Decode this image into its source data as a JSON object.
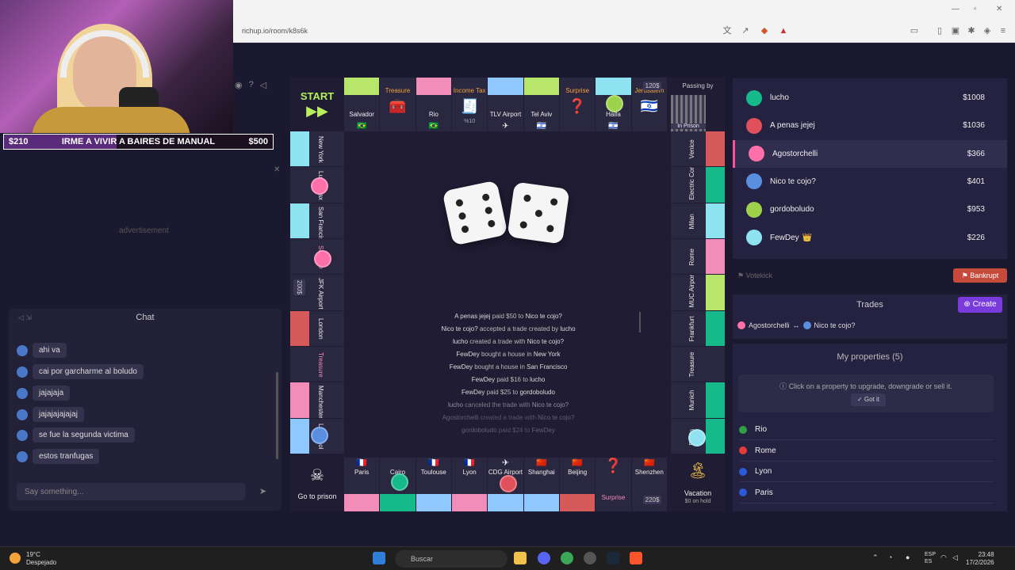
{
  "browser": {
    "url": "richup.io/room/k8s6k"
  },
  "stream_goal": {
    "current": "$210",
    "text": "IRME A VIVIR A BAIRES DE MANUAL",
    "target": "$500",
    "progress": 0.42
  },
  "left_panel": {
    "advertisement_label": "advertisement",
    "chat": {
      "title": "Chat",
      "messages": [
        "ahi va",
        "cai por garcharme al boludo",
        "jajajaja",
        "jajajajajajaj",
        "se fue la segunda victima",
        "estos tranfugas"
      ],
      "input_placeholder": "Say something..."
    }
  },
  "board": {
    "top_row": [
      "Salvador",
      "Treasure",
      "Rio",
      "Income Tax",
      "TLV Airport",
      "Tel Aviv",
      "Surprise",
      "Haifa",
      "Jerusalem"
    ],
    "corners": {
      "start": "START",
      "passing_by": "Passing by",
      "in_prison": "In Prison",
      "go_to_prison": "Go to prison",
      "vacation": "Vacation",
      "vacation_sub": "$0 on hold"
    },
    "income_tax_sub": "%10",
    "price_top": "120$",
    "price_bottom": "220$",
    "price_left": "200$",
    "left_col": [
      "New York",
      "Luxury tax",
      "San Francisco",
      "Surprise",
      "JFK Airport",
      "London",
      "Treasure",
      "Manchester",
      "Liverpool"
    ],
    "right_col": [
      "Venice",
      "Electric Company",
      "Milan",
      "Rome",
      "MUC Airport",
      "Frankfurt",
      "Treasure",
      "Munich",
      "Berlin"
    ],
    "bottom_row": [
      "Paris",
      "Cairo",
      "Toulouse",
      "Lyon",
      "CDG Airport",
      "Shanghai",
      "Beijing",
      "Surprise",
      "Shenzhen"
    ],
    "log": [
      {
        "a": "A penas jejej",
        "t": "paid $50 to",
        "b": "Nico te cojo?"
      },
      {
        "a": "Nico te cojo?",
        "t": "accepted a trade created by",
        "b": "lucho"
      },
      {
        "a": "lucho",
        "t": "created a trade with",
        "b": "Nico te cojo?"
      },
      {
        "a": "FewDey",
        "t": "bought a house in",
        "b": "New York"
      },
      {
        "a": "FewDey",
        "t": "bought a house in",
        "b": "San Francisco"
      },
      {
        "a": "FewDey",
        "t": "paid $16 to",
        "b": "lucho"
      },
      {
        "a": "FewDey",
        "t": "paid $25 to",
        "b": "gordoboludo"
      },
      {
        "a": "lucho",
        "t": "canceled the trade with",
        "b": "Nico te cojo?"
      },
      {
        "a": "Agostorchelli",
        "t": "created a trade with",
        "b": "Nico te cojo?"
      },
      {
        "a": "gordoboludo",
        "t": "paid $24 to",
        "b": "FewDey"
      }
    ]
  },
  "players": [
    {
      "name": "lucho",
      "money": "$1008",
      "color": "#16b98a"
    },
    {
      "name": "A penas jejej",
      "money": "$1036",
      "color": "#e0505a"
    },
    {
      "name": "Agostorchelli",
      "money": "$366",
      "color": "#ff6fa8"
    },
    {
      "name": "Nico te cojo?",
      "money": "$401",
      "color": "#5a8fe0"
    },
    {
      "name": "gordoboludo",
      "money": "$953",
      "color": "#9dd24a"
    },
    {
      "name": "FewDey",
      "money": "$226",
      "color": "#8fe3f0",
      "crown": "👑"
    }
  ],
  "actions": {
    "votekick": "Votekick",
    "bankrupt": "Bankrupt",
    "create": "Create"
  },
  "trades": {
    "title": "Trades",
    "from": "Agostorchelli",
    "arrow": "↔",
    "to": "Nico te cojo?"
  },
  "my_properties": {
    "title": "My properties (5)",
    "hint": "Click on a property to upgrade, downgrade or sell it.",
    "got_it": "Got it",
    "items": [
      {
        "name": "Rio",
        "color": "#2ea043"
      },
      {
        "name": "Rome",
        "color": "#e33a3a"
      },
      {
        "name": "Lyon",
        "color": "#2a5bd7"
      },
      {
        "name": "Paris",
        "color": "#2a5bd7"
      }
    ]
  },
  "taskbar": {
    "temp": "19°C",
    "weather": "Despejado",
    "search": "Buscar",
    "lang1": "ESP",
    "lang2": "ES",
    "time": "23:48",
    "date": "17/2/2026"
  }
}
